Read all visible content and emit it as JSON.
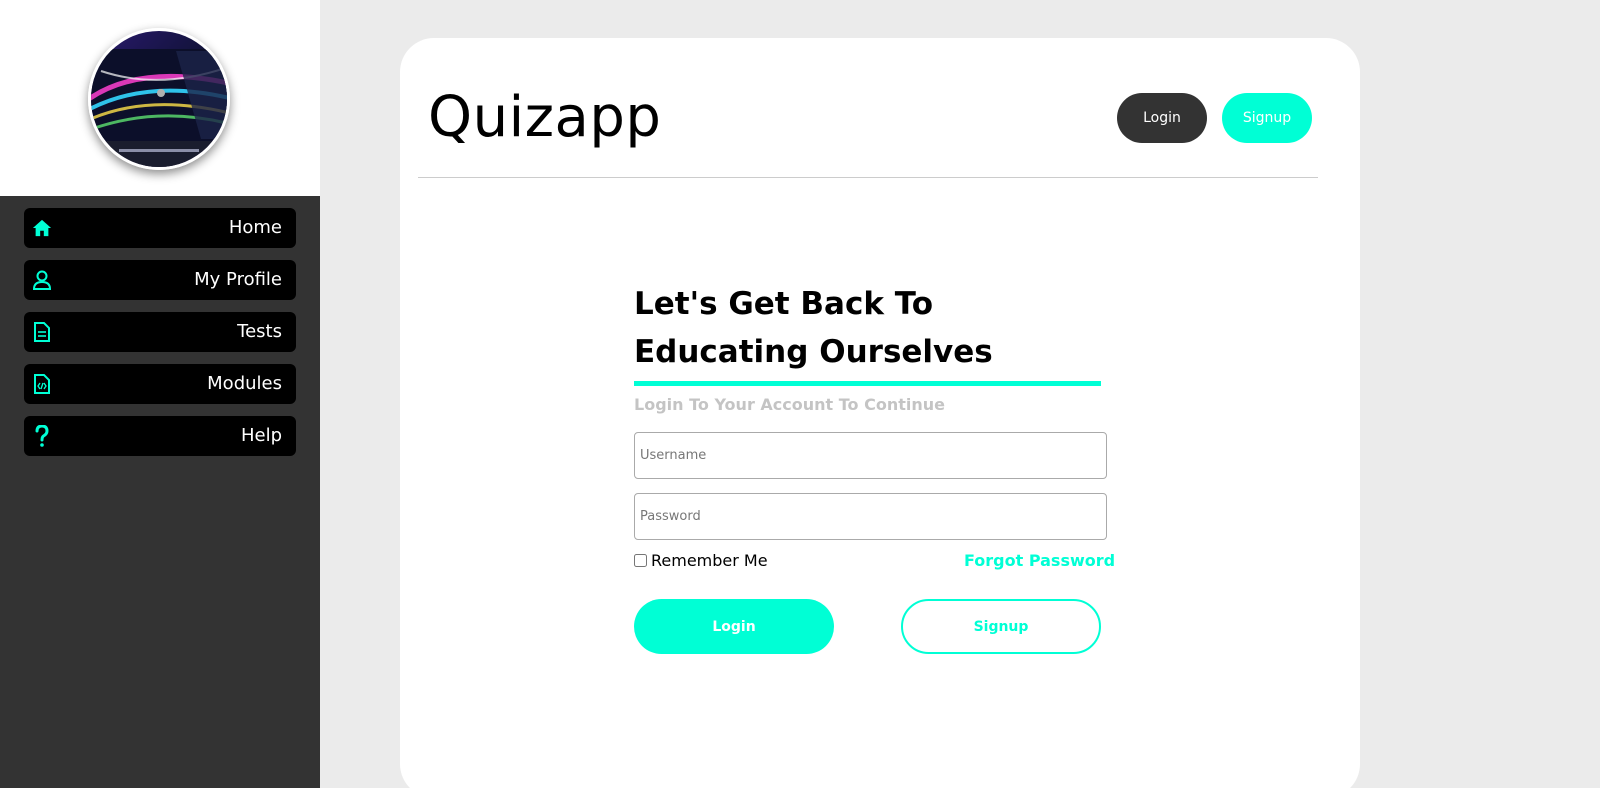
{
  "sidebar": {
    "items": [
      {
        "label": "Home",
        "icon": "home-icon"
      },
      {
        "label": "My Profile",
        "icon": "user-icon"
      },
      {
        "label": "Tests",
        "icon": "document-icon"
      },
      {
        "label": "Modules",
        "icon": "code-file-icon"
      },
      {
        "label": "Help",
        "icon": "question-icon"
      }
    ]
  },
  "header": {
    "brand": "Quizapp",
    "login_label": "Login",
    "signup_label": "Signup"
  },
  "form": {
    "title": "Let's Get Back To Educating Ourselves",
    "subtitle": "Login To Your Account To Continue",
    "username_placeholder": "Username",
    "password_placeholder": "Password",
    "remember_label": "Remember Me",
    "forgot_label": "Forgot Password",
    "login_label": "Login",
    "signup_label": "Signup"
  },
  "colors": {
    "accent": "#00ffd5",
    "sidebar_bg": "#333333",
    "nav_item_bg": "#000000",
    "page_bg": "#ebebeb",
    "header_login_bg": "#333333"
  }
}
